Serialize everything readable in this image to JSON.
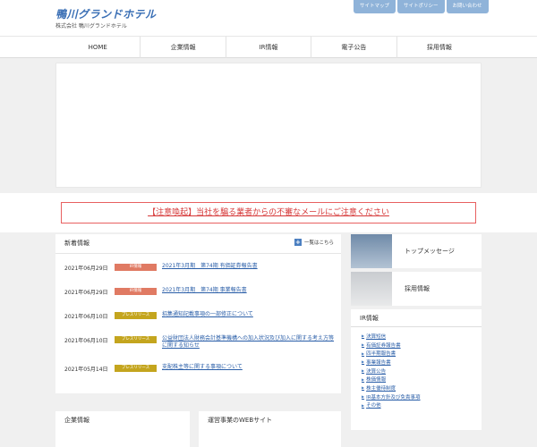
{
  "header": {
    "logo": "鴨川グランドホテル",
    "company": "株式会社 鴨川グランドホテル",
    "util_links": [
      "サイトマップ",
      "サイトポリシー",
      "お問い合わせ"
    ]
  },
  "nav": [
    "HOME",
    "企業情報",
    "IR情報",
    "電子公告",
    "採用情報"
  ],
  "notice": "【注意喚起】当社を騙る業者からの不審なメールにご注意ください",
  "news": {
    "title": "新着情報",
    "all_link": "一覧はこちら",
    "items": [
      {
        "date": "2021年06月29日",
        "badge": "IR情報",
        "text": "2021年3月期　第74期 有価証券報告書"
      },
      {
        "date": "2021年06月29日",
        "badge": "IR情報",
        "text": "2021年3月期　第74期 事業報告書"
      },
      {
        "date": "2021年06月10日",
        "badge": "プレスリリース",
        "text": "招集通知記載事項の一部修正について"
      },
      {
        "date": "2021年06月10日",
        "badge": "プレスリリース",
        "text": "公益財団法人財務会計基準機構への加入状況及び加入に関する考え方等に関する知らせ"
      },
      {
        "date": "2021年05月14日",
        "badge": "プレスリリース",
        "text": "支配株主等に関する事項について"
      }
    ]
  },
  "side": {
    "top_message": "トップメッセージ",
    "recruit": "採用情報",
    "ir_title": "IR情報",
    "ir_links": [
      "決算短信",
      "有価証券報告書",
      "四半期報告書",
      "事業報告書",
      "決算公告",
      "株価情報",
      "株主優待制度",
      "IR基本方針及び免責事項",
      "その他"
    ]
  },
  "bottom": {
    "left_title": "企業情報",
    "right_title": "運営事業のWEBサイト"
  },
  "colors": {
    "badge_ir": "#e07a63",
    "badge_press": "#c4a51e",
    "accent": "#3a6fb5"
  }
}
